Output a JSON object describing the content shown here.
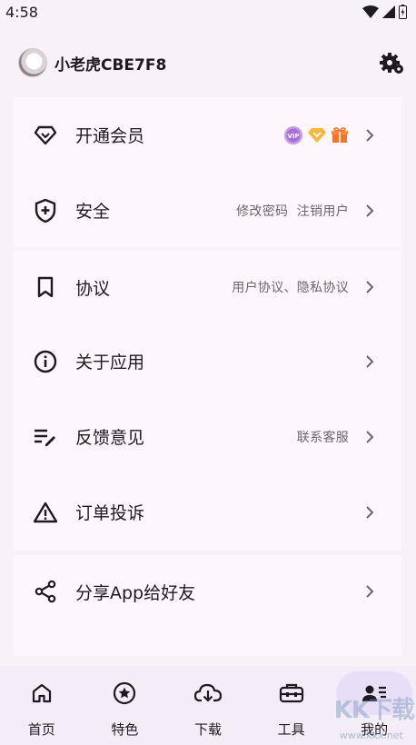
{
  "status_bar": {
    "time": "4:58"
  },
  "header": {
    "username": "小老虎CBE7F8"
  },
  "card1": [
    {
      "label": "开通会员",
      "hint": "",
      "badges": [
        "vip-badge",
        "diamond-badge",
        "gift-badge"
      ]
    },
    {
      "label": "安全",
      "hint": "修改密码  注销用户"
    }
  ],
  "card2": [
    {
      "label": "协议",
      "hint": "用户协议、隐私协议"
    },
    {
      "label": "关于应用",
      "hint": ""
    },
    {
      "label": "反馈意见",
      "hint": "联系客服"
    },
    {
      "label": "订单投诉",
      "hint": ""
    }
  ],
  "card3": [
    {
      "label": "分享App给好友",
      "hint": ""
    }
  ],
  "vip_badge_text": "VIP",
  "bottom_nav": [
    {
      "label": "首页",
      "icon": "home-icon"
    },
    {
      "label": "特色",
      "icon": "star-circle-icon"
    },
    {
      "label": "下载",
      "icon": "cloud-download-icon"
    },
    {
      "label": "工具",
      "icon": "toolbox-icon"
    },
    {
      "label": "我的",
      "icon": "profile-icon",
      "active": true
    }
  ],
  "watermark": {
    "text": "KK下载",
    "url": "www.kkx.net"
  },
  "colors": {
    "background": "#f7f1f8",
    "card": "#fdf7fd",
    "active_pill": "#e8def8",
    "nav_bg": "#f3edf7"
  }
}
